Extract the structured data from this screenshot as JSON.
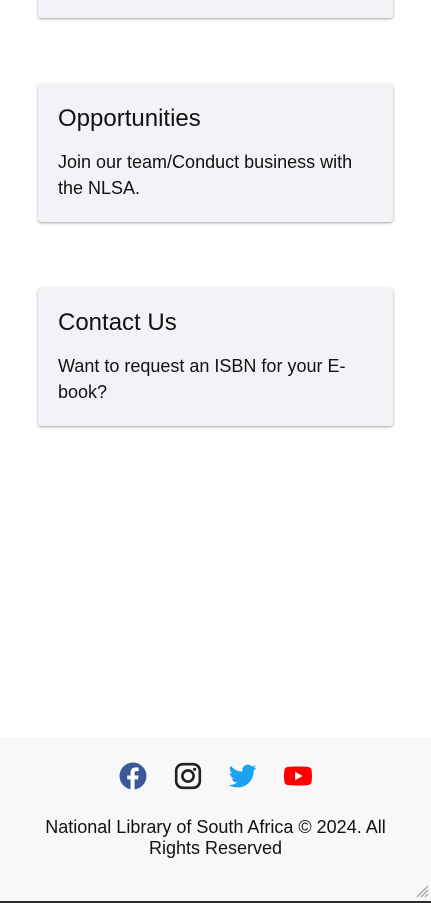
{
  "cards": [
    {
      "title": "Opportunities",
      "text": "Join our team/Conduct business with the NLSA."
    },
    {
      "title": "Contact Us",
      "text": "Want to request an ISBN for your E-book?"
    }
  ],
  "footer": {
    "social": [
      {
        "icon": "facebook-icon",
        "color": "#3b5998"
      },
      {
        "icon": "instagram-icon",
        "color": "#222222"
      },
      {
        "icon": "twitter-icon",
        "color": "#1da1f2"
      },
      {
        "icon": "youtube-icon",
        "color": "#ff0000"
      }
    ],
    "copyright": "National Library of South Africa © 2024. All Rights Reserved"
  }
}
